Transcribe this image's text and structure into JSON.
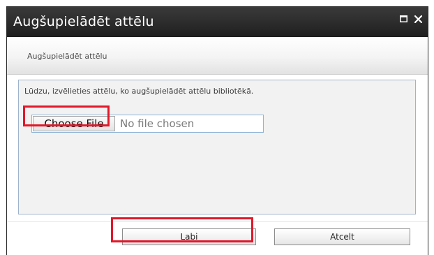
{
  "dialog": {
    "title": "Augšupielādēt attēlu",
    "window_buttons": {
      "maximize_icon": "maximize-icon",
      "close_icon": "close-icon"
    }
  },
  "ribbon": {
    "tab_label": "Augšupielādēt attēlu"
  },
  "content": {
    "instruction": "Lūdzu, izvēlieties attēlu, ko augšupielādēt attēlu bibliotēkā.",
    "file_input": {
      "button_label": "Choose File",
      "status": "No file chosen"
    }
  },
  "footer": {
    "ok_label": "Labi",
    "cancel_label": "Atcelt"
  },
  "colors": {
    "titlebar": "#2b2b2b",
    "panel_border": "#9fb4cc",
    "highlight": "#e0182a"
  }
}
